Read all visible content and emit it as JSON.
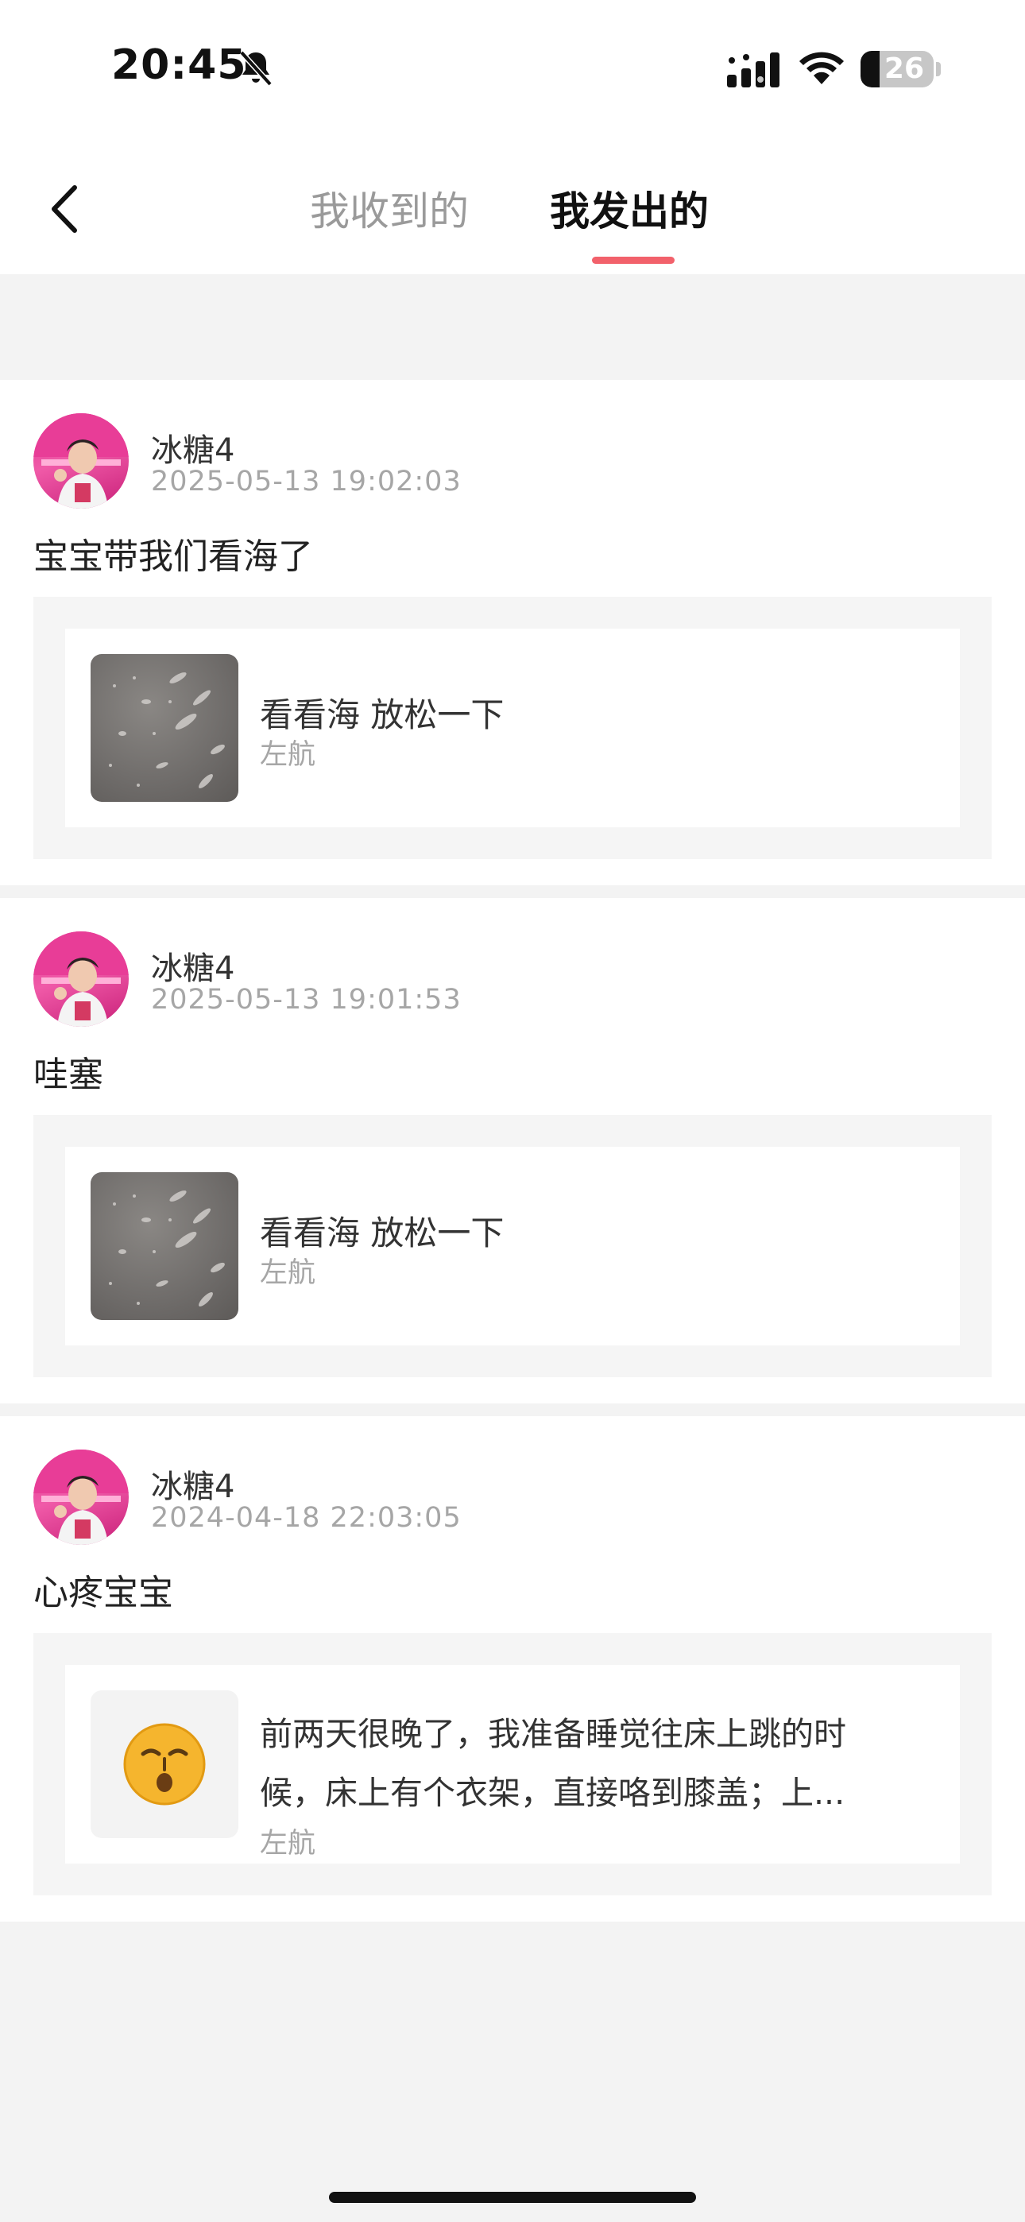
{
  "status_bar": {
    "time": "20:45",
    "battery_level": "26"
  },
  "tabs": {
    "received": "我收到的",
    "sent": "我发出的",
    "active": "sent"
  },
  "comments": [
    {
      "username": "冰糖4",
      "timestamp": "2025-05-13 19:02:03",
      "text": "宝宝带我们看海了",
      "post": {
        "title": "看看海 放松一下",
        "author": "左航"
      }
    },
    {
      "username": "冰糖4",
      "timestamp": "2025-05-13 19:01:53",
      "text": "哇塞",
      "post": {
        "title": "看看海 放松一下",
        "author": "左航"
      }
    },
    {
      "username": "冰糖4",
      "timestamp": "2024-04-18 22:03:05",
      "text": "心疼宝宝",
      "post": {
        "text_line1": "前两天很晚了，我准备睡觉往床上跳的时",
        "text_line2": "候，床上有个衣架，直接咯到膝盖；上...",
        "author": "左航"
      }
    }
  ],
  "colors": {
    "accent": "#f2616b",
    "background": "#f3f3f3",
    "quote_bg": "#f5f5f5"
  }
}
